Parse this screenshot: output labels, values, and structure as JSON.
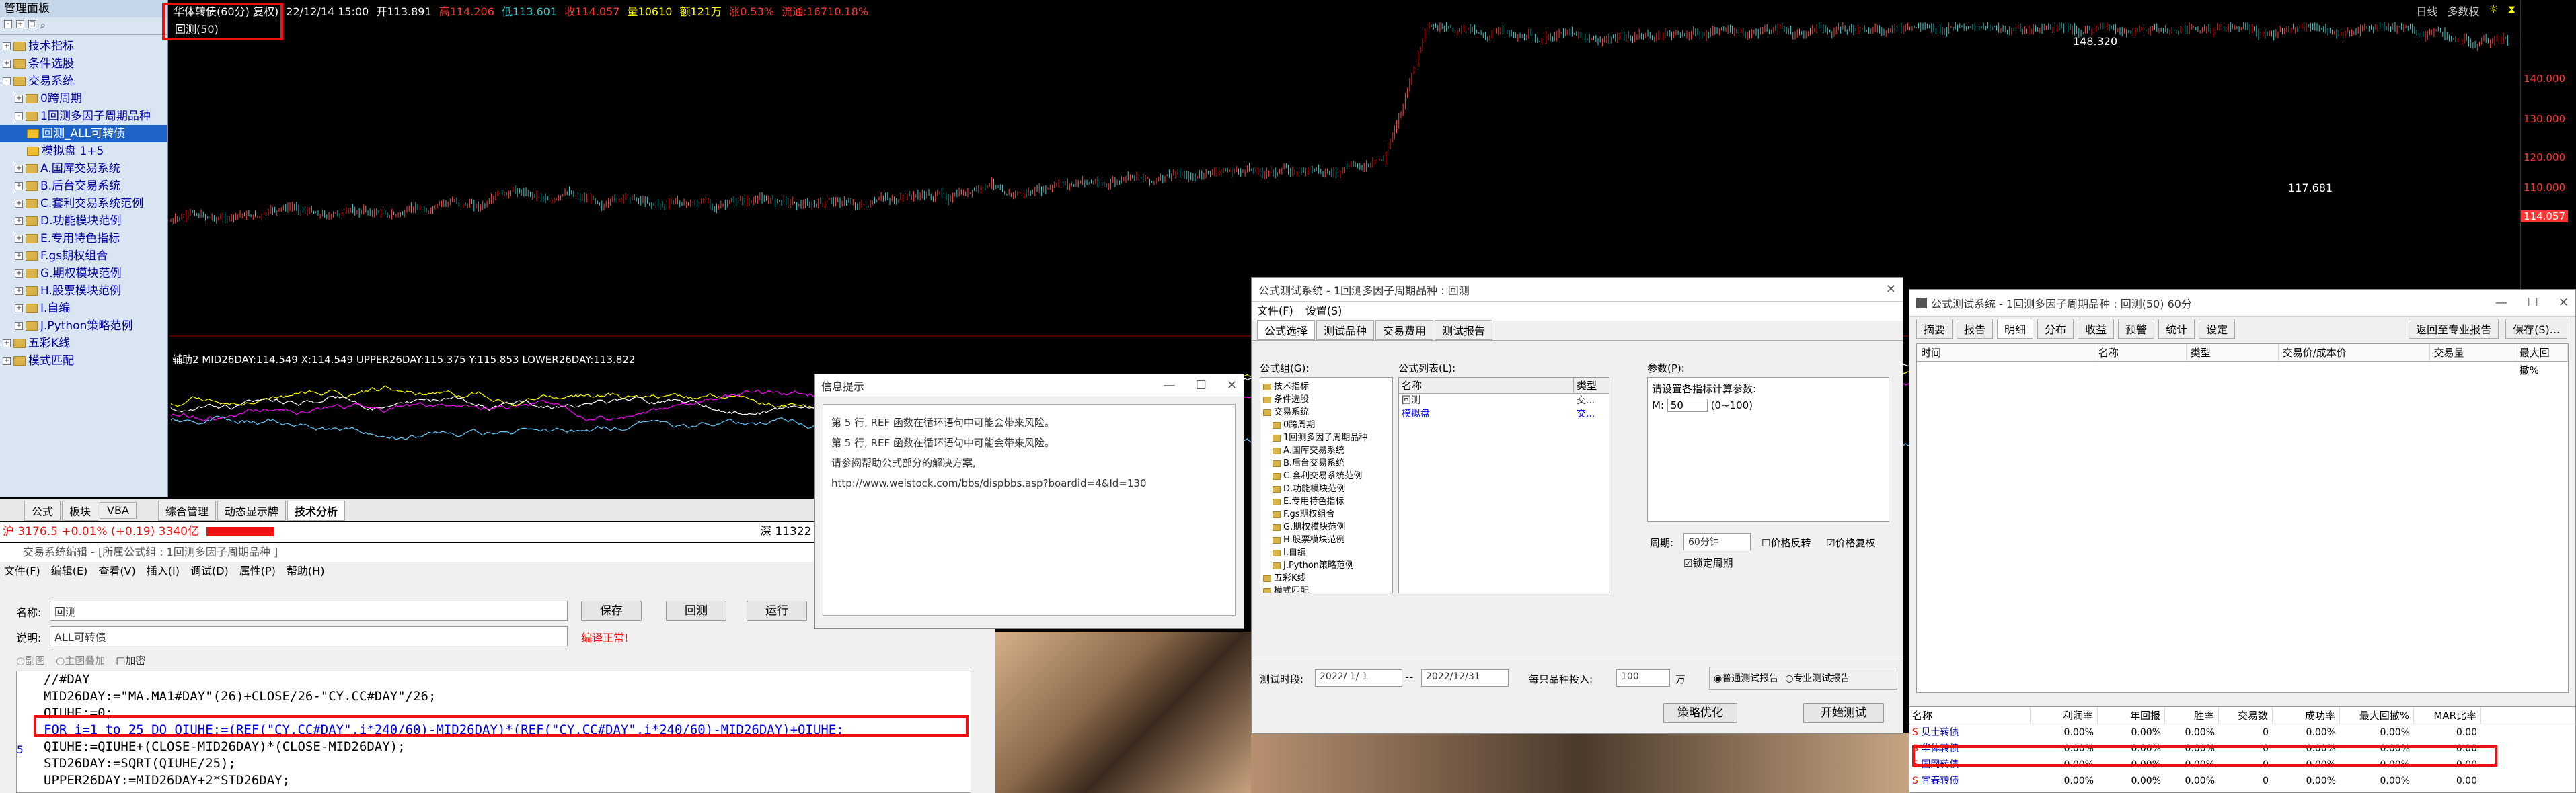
{
  "left_panel": {
    "title": "管理面板",
    "items": [
      {
        "label": "技术指标",
        "level": 0,
        "type": "plus"
      },
      {
        "label": "条件选股",
        "level": 0,
        "type": "plus"
      },
      {
        "label": "交易系统",
        "level": 0,
        "type": "minus"
      },
      {
        "label": "0跨周期",
        "level": 1,
        "type": "plus"
      },
      {
        "label": "1回测多因子周期品种",
        "level": 1,
        "type": "minus"
      },
      {
        "label": "回测_ALL可转债",
        "level": 2,
        "type": "leaf",
        "selected": true
      },
      {
        "label": "模拟盘 1+5",
        "level": 2,
        "type": "leaf"
      },
      {
        "label": "A.国库交易系统",
        "level": 1,
        "type": "plus"
      },
      {
        "label": "B.后台交易系统",
        "level": 1,
        "type": "plus"
      },
      {
        "label": "C.套利交易系统范例",
        "level": 1,
        "type": "plus"
      },
      {
        "label": "D.功能模块范例",
        "level": 1,
        "type": "plus"
      },
      {
        "label": "E.专用特色指标",
        "level": 1,
        "type": "plus"
      },
      {
        "label": "F.gs期权组合",
        "level": 1,
        "type": "plus"
      },
      {
        "label": "G.期权模块范例",
        "level": 1,
        "type": "plus"
      },
      {
        "label": "H.股票模块范例",
        "level": 1,
        "type": "plus"
      },
      {
        "label": "I.自编",
        "level": 1,
        "type": "plus"
      },
      {
        "label": "J.Python策略范例",
        "level": 1,
        "type": "plus"
      },
      {
        "label": "五彩K线",
        "level": 0,
        "type": "plus"
      },
      {
        "label": "模式匹配",
        "level": 0,
        "type": "plus"
      }
    ]
  },
  "chart_header": {
    "name": "华体转债(60分)",
    "mode": "复权)",
    "datetime": "22/12/14 15:00",
    "open": "开113.891",
    "high": "高114.206",
    "low": "低113.601",
    "close": "收114.057",
    "vol": "量10610",
    "amount": "额121万",
    "change": "涨0.53%",
    "shares": "流通:16710.18%",
    "indicator": "回测(50)",
    "right_btn1": "日线",
    "right_btn2": "多数权",
    "price_high": "148.320",
    "price_mid": "117.681",
    "last_price": "114.057"
  },
  "y_axis": [
    "140.000",
    "130.000",
    "120.000",
    "110.000"
  ],
  "sub_indicator": "辅助2 MID26DAY:114.549 X:114.549 UPPER26DAY:115.375 Y:115.853 LOWER26DAY:113.822",
  "bottom_tabs": [
    "公式",
    "板块",
    "VBA",
    "综合管理",
    "动态显示牌",
    "技术分析"
  ],
  "status": {
    "index": "沪 3176.5 +0.01% (+0.19) 3340亿",
    "right": "深 11322"
  },
  "editor": {
    "title": "交易系统编辑 - [所属公式组 : 1回测多因子周期品种 ]",
    "menu": [
      "文件(F)",
      "编辑(E)",
      "查看(V)",
      "插入(I)",
      "调试(D)",
      "属性(P)",
      "帮助(H)"
    ],
    "name_label": "名称:",
    "name_value": "回测",
    "desc_label": "说明:",
    "desc_value": "ALL可转债",
    "save": "保存",
    "backtest": "回测",
    "run": "运行",
    "compile_ok": "编译正常!",
    "opt1": "副图",
    "opt2": "主图叠加",
    "opt3": "加密",
    "code": [
      "//#DAY",
      "MID26DAY:=\"MA.MA1#DAY\"(26)+CLOSE/26-\"CY.CC#DAY\"/26;",
      "QIUHE:=0;",
      "FOR i=1 to 25 DO QIUHE:=(REF(\"CY.CC#DAY\",i*240/60)-MID26DAY)*(REF(\"CY.CC#DAY\",i*240/60)-MID26DAY)+QIUHE;",
      "QIUHE:=QIUHE+(CLOSE-MID26DAY)*(CLOSE-MID26DAY);",
      "STD26DAY:=SQRT(QIUHE/25);",
      "UPPER26DAY:=MID26DAY+2*STD26DAY;"
    ],
    "line_number": "5"
  },
  "message": {
    "title": "信息提示",
    "lines": [
      "第 5 行, REF 函数在循环语句中可能会带来风险。",
      "第 5 行, REF 函数在循环语句中可能会带来风险。",
      "请参阅帮助公式部分的解决方案,",
      "http://www.weistock.com/bbs/dispbbs.asp?boardid=4&Id=130"
    ]
  },
  "test_window": {
    "title": "公式测试系统 - 1回测多因子周期品种 : 回测",
    "menu": [
      "文件(F)",
      "设置(S)"
    ],
    "tabs": [
      "公式选择",
      "测试品种",
      "交易费用",
      "测试报告"
    ],
    "group_label": "公式组(G):",
    "list_label": "公式列表(L):",
    "params_label": "参数(P):",
    "tree": [
      "技术指标",
      "条件选股",
      "交易系统",
      "0跨周期",
      "1回测多因子周期品种",
      "A.国库交易系统",
      "B.后台交易系统",
      "C.套利交易系统范例",
      "D.功能模块范例",
      "E.专用特色指标",
      "F.gs期权组合",
      "G.期权模块范例",
      "H.股票模块范例",
      "I.自编",
      "J.Python策略范例",
      "五彩K线",
      "模式匹配"
    ],
    "list_cols": [
      "名称",
      "类型"
    ],
    "list_rows": [
      {
        "name": "回测",
        "type": "交..."
      },
      {
        "name": "模拟盘",
        "type": "交..."
      }
    ],
    "param_hint": "请设置各指标计算参数:",
    "param_name": "M:",
    "param_value": "50",
    "param_range": "(0~100)",
    "period_label": "周期:",
    "period_value": "60分钟",
    "price_reverse": "价格反转",
    "price_adjust": "价格复权",
    "lock_period": "锁定周期",
    "time_label": "测试时段:",
    "date_from": "2022/ 1/ 1",
    "date_to": "2022/12/31",
    "per_label": "每只品种投入:",
    "per_value": "100",
    "unit": "万",
    "report_normal": "普通测试报告",
    "report_pro": "专业测试报告",
    "optimize": "策略优化",
    "start": "开始测试"
  },
  "result_window": {
    "title": "公式测试系统 - 1回测多因子周期品种 : 回测(50) 60分",
    "tabs": [
      "摘要",
      "报告",
      "明细",
      "分布",
      "收益",
      "预警",
      "统计",
      "设定"
    ],
    "btn_pro": "返回至专业报告",
    "btn_save": "保存(S)...",
    "detail_cols": [
      "时间",
      "名称",
      "类型",
      "交易价/成本价",
      "交易量",
      "最大回撤%"
    ],
    "summary_cols": [
      "名称",
      "利润率",
      "年回报",
      "胜率",
      "交易数",
      "成功率",
      "最大回撤%",
      "MAR比率"
    ],
    "rows": [
      {
        "name": "贝士转债",
        "v": [
          "0.00%",
          "0.00%",
          "0.00%",
          "0",
          "0.00%",
          "0.00%",
          "0.00"
        ]
      },
      {
        "name": "华体转债",
        "v": [
          "0.00%",
          "0.00%",
          "0.00%",
          "0",
          "0.00%",
          "0.00%",
          "0.00"
        ]
      },
      {
        "name": "国网转债",
        "v": [
          "0.00%",
          "0.00%",
          "0.00%",
          "0",
          "0.00%",
          "0.00%",
          "0.00"
        ]
      },
      {
        "name": "宜春转债",
        "v": [
          "0.00%",
          "0.00%",
          "0.00%",
          "0",
          "0.00%",
          "0.00%",
          "0.00"
        ]
      }
    ]
  },
  "colors": {
    "accent": "#e11",
    "bg": "#000",
    "up": "#ff3030",
    "down": "#3ec8c8",
    "panel": "#d4e4f0"
  }
}
